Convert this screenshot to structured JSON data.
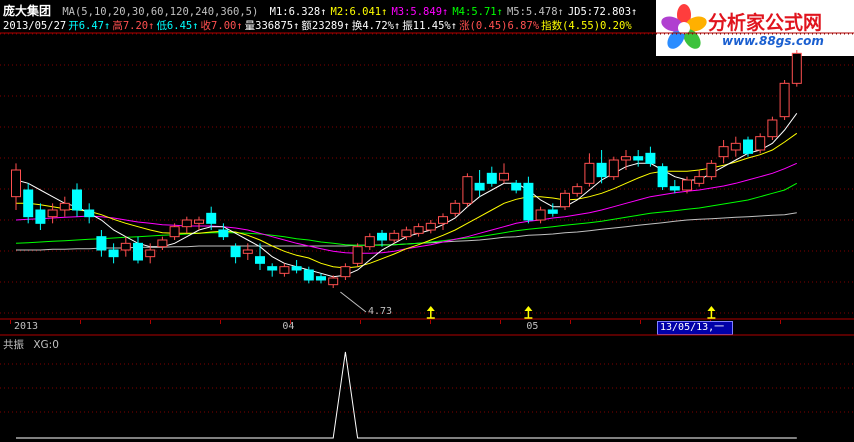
{
  "header": {
    "stock_name": "庞大集团",
    "ma_params": "MA(5,10,20,30,60,120,240,360,5)",
    "ma_values": [
      {
        "label": "M1:6.328",
        "color": "#ffffff"
      },
      {
        "label": "M2:6.041",
        "color": "#ffff00"
      },
      {
        "label": "M3:5.849",
        "color": "#ff00ff"
      },
      {
        "label": "M4:5.71",
        "color": "#00ff00"
      },
      {
        "label": "M5:5.478",
        "color": "#c0c0c0"
      },
      {
        "label": "JD5:72.803",
        "color": "#ffffff"
      }
    ],
    "quote_items": [
      {
        "label": "2013/05/27",
        "color": "#ffffff"
      },
      {
        "label": "开6.47",
        "color": "#00ffff"
      },
      {
        "label": "高7.20",
        "color": "#ff5050"
      },
      {
        "label": "低6.45",
        "color": "#00ffff"
      },
      {
        "label": "收7.00",
        "color": "#ff5050"
      },
      {
        "label": "量336875",
        "color": "#ffffff"
      },
      {
        "label": "额23289",
        "color": "#ffffff"
      },
      {
        "label": "换4.72%",
        "color": "#ffffff"
      },
      {
        "label": "振11.45%",
        "color": "#ffffff"
      },
      {
        "label": "涨(0.45)6.87%",
        "color": "#ff5050"
      },
      {
        "label": "指数(4.55)0.20%",
        "color": "#ffff00"
      }
    ]
  },
  "logo": {
    "title": "分析家公式网",
    "url": "www.88gs.com",
    "colors": {
      "title": "#e0141e",
      "url": "#1a5fd0"
    }
  },
  "colors": {
    "up": "#ff5050",
    "down": "#00ffff",
    "axis": "#b00000",
    "ma1": "#ffffff",
    "ma2": "#ffff00",
    "ma3": "#ff00ff",
    "ma4": "#00ff00",
    "ma5": "#c0c0c0",
    "marker": "#ffff00",
    "indicator": "#ffffff"
  },
  "price_panel": {
    "low_label": "4.73",
    "candles": [
      [
        6.1,
        6.6,
        5.9,
        6.5
      ],
      [
        6.2,
        6.3,
        5.7,
        5.8
      ],
      [
        5.9,
        6.0,
        5.6,
        5.7
      ],
      [
        5.8,
        6.0,
        5.7,
        5.9
      ],
      [
        5.9,
        6.1,
        5.8,
        6.0
      ],
      [
        6.2,
        6.3,
        5.8,
        5.9
      ],
      [
        5.9,
        6.0,
        5.7,
        5.8
      ],
      [
        5.5,
        5.6,
        5.2,
        5.3
      ],
      [
        5.3,
        5.4,
        5.1,
        5.2
      ],
      [
        5.3,
        5.5,
        5.2,
        5.4
      ],
      [
        5.4,
        5.5,
        5.1,
        5.15
      ],
      [
        5.2,
        5.4,
        5.1,
        5.3
      ],
      [
        5.35,
        5.5,
        5.3,
        5.45
      ],
      [
        5.5,
        5.7,
        5.45,
        5.65
      ],
      [
        5.65,
        5.8,
        5.55,
        5.75
      ],
      [
        5.7,
        5.8,
        5.6,
        5.75
      ],
      [
        5.85,
        5.95,
        5.6,
        5.7
      ],
      [
        5.6,
        5.7,
        5.45,
        5.5
      ],
      [
        5.35,
        5.4,
        5.1,
        5.2
      ],
      [
        5.25,
        5.4,
        5.15,
        5.3
      ],
      [
        5.2,
        5.4,
        5.0,
        5.1
      ],
      [
        5.05,
        5.1,
        4.9,
        5.0
      ],
      [
        4.95,
        5.1,
        4.9,
        5.05
      ],
      [
        5.05,
        5.15,
        4.95,
        5.0
      ],
      [
        5.0,
        5.05,
        4.8,
        4.85
      ],
      [
        4.9,
        4.95,
        4.8,
        4.85
      ],
      [
        4.78,
        4.92,
        4.73,
        4.88
      ],
      [
        4.9,
        5.1,
        4.85,
        5.05
      ],
      [
        5.1,
        5.4,
        5.05,
        5.35
      ],
      [
        5.35,
        5.55,
        5.3,
        5.5
      ],
      [
        5.55,
        5.6,
        5.35,
        5.45
      ],
      [
        5.45,
        5.6,
        5.4,
        5.55
      ],
      [
        5.5,
        5.65,
        5.45,
        5.6
      ],
      [
        5.55,
        5.7,
        5.5,
        5.65
      ],
      [
        5.6,
        5.75,
        5.55,
        5.7
      ],
      [
        5.7,
        5.85,
        5.6,
        5.8
      ],
      [
        5.85,
        6.05,
        5.8,
        6.0
      ],
      [
        6.0,
        6.45,
        5.95,
        6.4
      ],
      [
        6.3,
        6.5,
        6.1,
        6.2
      ],
      [
        6.45,
        6.55,
        6.25,
        6.3
      ],
      [
        6.35,
        6.6,
        6.3,
        6.45
      ],
      [
        6.3,
        6.35,
        6.15,
        6.2
      ],
      [
        6.3,
        6.4,
        5.7,
        5.75
      ],
      [
        5.75,
        5.95,
        5.7,
        5.9
      ],
      [
        5.9,
        6.0,
        5.8,
        5.85
      ],
      [
        5.95,
        6.2,
        5.9,
        6.15
      ],
      [
        6.15,
        6.3,
        6.1,
        6.25
      ],
      [
        6.3,
        6.75,
        6.25,
        6.6
      ],
      [
        6.6,
        6.8,
        6.3,
        6.4
      ],
      [
        6.4,
        6.7,
        6.35,
        6.65
      ],
      [
        6.65,
        6.8,
        6.5,
        6.7
      ],
      [
        6.7,
        6.8,
        6.55,
        6.65
      ],
      [
        6.75,
        6.85,
        6.55,
        6.6
      ],
      [
        6.55,
        6.6,
        6.2,
        6.25
      ],
      [
        6.25,
        6.35,
        6.15,
        6.2
      ],
      [
        6.2,
        6.4,
        6.15,
        6.35
      ],
      [
        6.3,
        6.5,
        6.25,
        6.4
      ],
      [
        6.4,
        6.65,
        6.35,
        6.6
      ],
      [
        6.7,
        6.95,
        6.6,
        6.85
      ],
      [
        6.8,
        7.0,
        6.7,
        6.9
      ],
      [
        6.95,
        7.0,
        6.7,
        6.75
      ],
      [
        6.8,
        7.05,
        6.75,
        7.0
      ],
      [
        7.0,
        7.3,
        6.95,
        7.25
      ],
      [
        7.3,
        7.85,
        7.25,
        7.8
      ],
      [
        7.8,
        8.3,
        7.75,
        8.25
      ]
    ],
    "ma_lines": {
      "ma1": [
        6.35,
        6.3,
        6.2,
        6.1,
        6.0,
        5.95,
        5.85,
        5.75,
        5.6,
        5.5,
        5.4,
        5.35,
        5.35,
        5.4,
        5.5,
        5.6,
        5.65,
        5.65,
        5.55,
        5.45,
        5.35,
        5.2,
        5.1,
        5.05,
        5.0,
        4.95,
        4.9,
        4.92,
        5.0,
        5.15,
        5.3,
        5.4,
        5.5,
        5.55,
        5.6,
        5.68,
        5.78,
        5.95,
        6.1,
        6.2,
        6.3,
        6.3,
        6.2,
        6.05,
        5.95,
        5.95,
        6.05,
        6.2,
        6.35,
        6.45,
        6.55,
        6.6,
        6.6,
        6.5,
        6.4,
        6.35,
        6.35,
        6.45,
        6.55,
        6.65,
        6.75,
        6.8,
        6.9,
        7.1,
        7.35
      ],
      "ma2": [
        6.0,
        6.0,
        5.98,
        5.95,
        5.92,
        5.9,
        5.88,
        5.83,
        5.76,
        5.7,
        5.65,
        5.6,
        5.56,
        5.55,
        5.55,
        5.55,
        5.57,
        5.58,
        5.57,
        5.52,
        5.45,
        5.36,
        5.28,
        5.22,
        5.18,
        5.1,
        5.05,
        5.03,
        5.05,
        5.1,
        5.17,
        5.24,
        5.32,
        5.38,
        5.45,
        5.52,
        5.6,
        5.7,
        5.8,
        5.9,
        6.0,
        6.06,
        6.1,
        6.1,
        6.08,
        6.05,
        6.06,
        6.1,
        6.15,
        6.22,
        6.3,
        6.38,
        6.45,
        6.48,
        6.48,
        6.48,
        6.5,
        6.53,
        6.57,
        6.62,
        6.68,
        6.73,
        6.8,
        6.92,
        7.05
      ],
      "ma3": [
        5.75,
        5.76,
        5.77,
        5.78,
        5.79,
        5.8,
        5.81,
        5.8,
        5.78,
        5.75,
        5.72,
        5.7,
        5.68,
        5.67,
        5.66,
        5.66,
        5.66,
        5.65,
        5.63,
        5.6,
        5.55,
        5.5,
        5.45,
        5.4,
        5.36,
        5.32,
        5.28,
        5.26,
        5.25,
        5.25,
        5.26,
        5.28,
        5.32,
        5.35,
        5.38,
        5.42,
        5.46,
        5.5,
        5.55,
        5.6,
        5.65,
        5.7,
        5.73,
        5.75,
        5.78,
        5.8,
        5.83,
        5.86,
        5.9,
        5.95,
        6.0,
        6.05,
        6.1,
        6.13,
        6.16,
        6.18,
        6.2,
        6.23,
        6.26,
        6.3,
        6.35,
        6.4,
        6.45,
        6.52,
        6.6
      ],
      "ma4": [
        5.4,
        5.41,
        5.42,
        5.43,
        5.44,
        5.45,
        5.46,
        5.47,
        5.48,
        5.49,
        5.5,
        5.51,
        5.52,
        5.53,
        5.54,
        5.55,
        5.56,
        5.56,
        5.56,
        5.55,
        5.54,
        5.52,
        5.5,
        5.47,
        5.45,
        5.42,
        5.4,
        5.38,
        5.37,
        5.37,
        5.37,
        5.38,
        5.39,
        5.4,
        5.42,
        5.44,
        5.46,
        5.48,
        5.5,
        5.53,
        5.56,
        5.59,
        5.61,
        5.63,
        5.65,
        5.67,
        5.69,
        5.71,
        5.73,
        5.76,
        5.79,
        5.82,
        5.85,
        5.87,
        5.89,
        5.91,
        5.93,
        5.96,
        5.99,
        6.02,
        6.05,
        6.1,
        6.15,
        6.2,
        6.3
      ],
      "ma5": [
        5.3,
        5.3,
        5.3,
        5.31,
        5.31,
        5.32,
        5.32,
        5.33,
        5.33,
        5.33,
        5.34,
        5.34,
        5.34,
        5.35,
        5.35,
        5.36,
        5.36,
        5.36,
        5.36,
        5.36,
        5.36,
        5.36,
        5.36,
        5.36,
        5.36,
        5.36,
        5.36,
        5.36,
        5.37,
        5.37,
        5.38,
        5.38,
        5.39,
        5.4,
        5.41,
        5.42,
        5.43,
        5.44,
        5.45,
        5.47,
        5.49,
        5.5,
        5.52,
        5.53,
        5.54,
        5.56,
        5.57,
        5.59,
        5.61,
        5.63,
        5.65,
        5.67,
        5.69,
        5.71,
        5.73,
        5.75,
        5.76,
        5.77,
        5.78,
        5.79,
        5.8,
        5.81,
        5.82,
        5.83,
        5.86
      ]
    },
    "markers": [
      34,
      42,
      57
    ]
  },
  "date_axis": {
    "labels": [
      {
        "text": "2013",
        "index": 0
      },
      {
        "text": "04",
        "index": 22
      },
      {
        "text": "05",
        "index": 42
      }
    ],
    "cursor_label": "13/05/13,一"
  },
  "indicator_panel": {
    "name": "共振",
    "value_label": "XG:0",
    "values": [
      0,
      0,
      0,
      0,
      0,
      0,
      0,
      0,
      0,
      0,
      0,
      0,
      0,
      0,
      0,
      0,
      0,
      0,
      0,
      0,
      0,
      0,
      0,
      0,
      0,
      0,
      0,
      1,
      0,
      0,
      0,
      0,
      0,
      0,
      0,
      0,
      0,
      0,
      0,
      0,
      0,
      0,
      0,
      0,
      0,
      0,
      0,
      0,
      0,
      0,
      0,
      0,
      0,
      0,
      0,
      0,
      0,
      0,
      0,
      0,
      0,
      0,
      0,
      0,
      0
    ]
  }
}
